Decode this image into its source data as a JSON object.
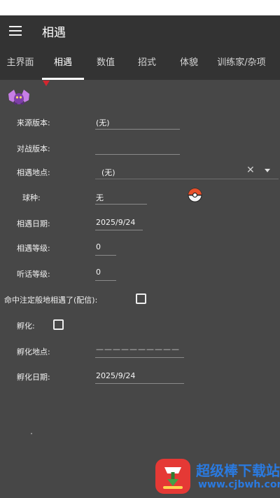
{
  "app": {
    "title": "相遇"
  },
  "tabs": [
    {
      "label": "主界面"
    },
    {
      "label": "相遇"
    },
    {
      "label": "数值"
    },
    {
      "label": "招式"
    },
    {
      "label": "体貌"
    },
    {
      "label": "训练家/杂项"
    }
  ],
  "active_tab": "相遇",
  "form": {
    "origin_version": {
      "label": "来源版本:",
      "value": "(无)"
    },
    "battle_version": {
      "label": "对战版本:",
      "value": ""
    },
    "met_location": {
      "label": "相遇地点:",
      "value": "(无)",
      "clear_icon": "close-icon"
    },
    "ball": {
      "label": "球种:",
      "value": "无",
      "icon": "poke-ball-icon"
    },
    "met_date": {
      "label": "相遇日期:",
      "value": "2025/9/24"
    },
    "met_level": {
      "label": "相遇等级:",
      "value": "0"
    },
    "obedience_level": {
      "label": "听话等级:",
      "value": "0"
    },
    "fateful": {
      "label": "命中注定般地相遇了(配信):",
      "checked": false
    },
    "hatch": {
      "label": "孵化:",
      "checked": false
    },
    "hatch_location": {
      "label": "孵化地点:",
      "value": "——————————"
    },
    "hatch_date": {
      "label": "孵化日期:",
      "value": "2025/9/24"
    }
  },
  "watermark": {
    "name": "超级棒下载站",
    "url": "www.cjbwh.com"
  },
  "colors": {
    "background": "#474747",
    "appbar": "#333333",
    "indicator": "#ffffff"
  }
}
